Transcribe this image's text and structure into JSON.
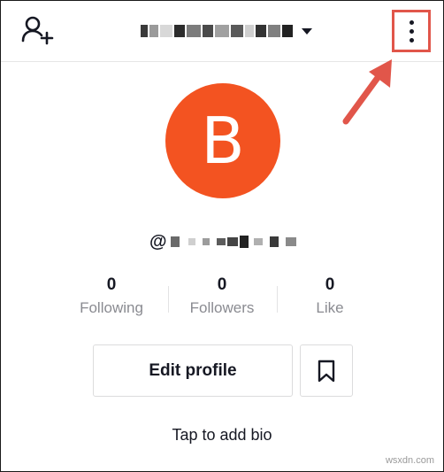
{
  "header": {
    "add_user_icon": "add-user-icon",
    "username_dropdown_icon": "caret-down-icon",
    "more_icon": "vertical-dots-icon"
  },
  "profile": {
    "avatar_initial": "B",
    "avatar_color": "#f35321",
    "username_prefix": "@"
  },
  "stats": [
    {
      "count": "0",
      "label": "Following"
    },
    {
      "count": "0",
      "label": "Followers"
    },
    {
      "count": "0",
      "label": "Like"
    }
  ],
  "actions": {
    "edit_profile_label": "Edit profile",
    "bookmark_icon": "bookmark-icon"
  },
  "bio_prompt": "Tap to add bio",
  "annotation": {
    "highlight_color": "#e1564a"
  },
  "watermark": "wsxdn.com"
}
